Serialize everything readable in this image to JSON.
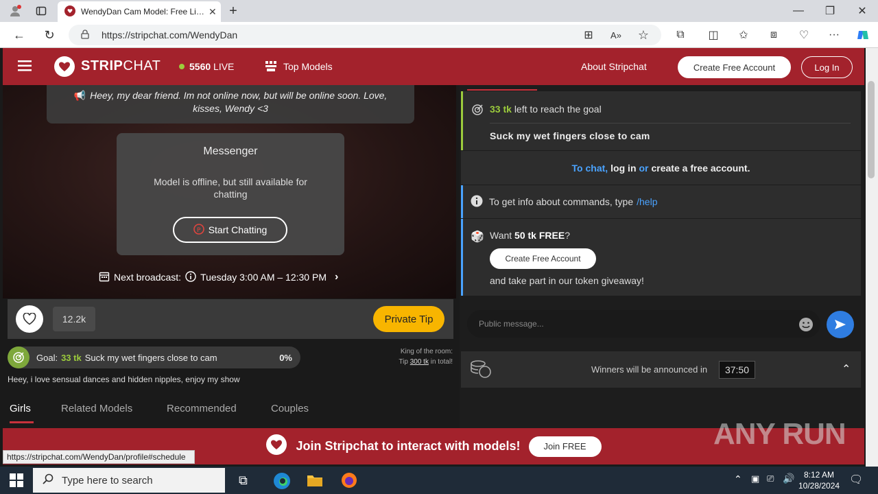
{
  "browser": {
    "tab_title": "WendyDan Cam Model: Free Live",
    "url": "https://stripchat.com/WendyDan",
    "status_url": "https://stripchat.com/WendyDan/profile#schedule"
  },
  "header": {
    "logo_text_bold": "STRIP",
    "logo_text_rest": "CHAT",
    "live_count": "5560",
    "live_label": "LIVE",
    "top_models": "Top Models",
    "about": "About Stripchat",
    "create_account": "Create Free Account",
    "login": "Log In"
  },
  "video": {
    "offline_message": "Heey, my dear friend. Im not online now, but will be online soon. Love, kisses, Wendy <3",
    "messenger_title": "Messenger",
    "messenger_text": "Model is offline, but still available for chatting",
    "start_chatting": "Start Chatting",
    "next_broadcast_label": "Next broadcast:",
    "next_broadcast_time": "Tuesday 3:00 AM – 12:30 PM",
    "likes": "12.2k",
    "private_tip": "Private Tip"
  },
  "goal": {
    "label": "Goal:",
    "amount": "33 tk",
    "text": "Suck my wet fingers close to cam",
    "percent": "0%",
    "progress": 0
  },
  "king": {
    "line1": "King of the room:",
    "tip_label": "Tip",
    "tip_amount": "300 tk",
    "tip_suffix": "in total!"
  },
  "bio": "Heey, i love sensual dances and hidden nipples, enjoy my show",
  "tabs": [
    "Girls",
    "Related Models",
    "Recommended",
    "Couples"
  ],
  "chat": {
    "goal_amount": "33 tk",
    "goal_left": "left to reach the goal",
    "goal_text": "Suck my wet fingers close to cam",
    "to_chat": "To chat,",
    "log_in": "log in",
    "or": "or",
    "create_free": "create a free account",
    "period": ".",
    "info_prefix": "To get info about commands, type",
    "help_cmd": "/help",
    "want": "Want",
    "free_tokens": "50 tk FREE",
    "question": "?",
    "create_account_btn": "Create Free Account",
    "giveaway": "and take part in our token giveaway!",
    "public_placeholder": "Public message...",
    "winners_text": "Winners will be announced in",
    "winners_timer": "37:50"
  },
  "banner": {
    "text": "Join Stripchat to interact with models!",
    "button": "Join FREE"
  },
  "taskbar": {
    "search_placeholder": "Type here to search",
    "time": "8:12 AM",
    "date": "10/28/2024"
  },
  "watermark": "ANY RUN",
  "colors": {
    "brand_red": "#a3222c",
    "goal_green": "#9ccc3c",
    "link_blue": "#4aa3ff",
    "tip_yellow": "#f8b500"
  }
}
